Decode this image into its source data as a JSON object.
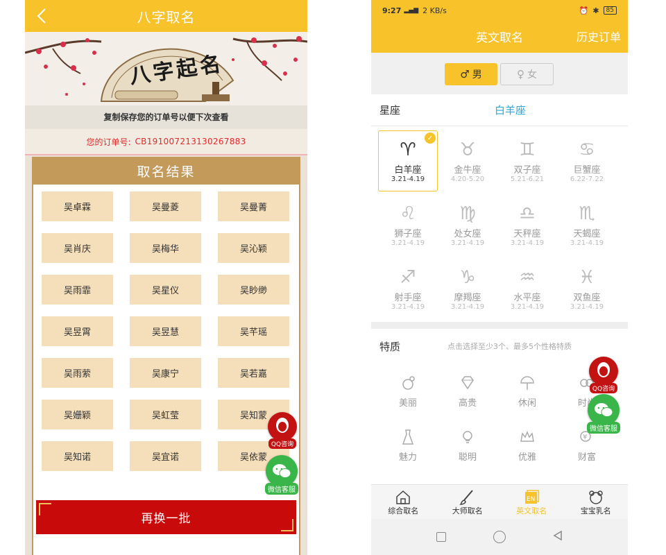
{
  "left": {
    "title": "八字取名",
    "banner_text": "八字起名",
    "copy_hint": "复制保存您的订单号以便下次查看",
    "order_label": "您的订单号:",
    "order_number": "CB191007213130267883",
    "result_title": "取名结果",
    "names": [
      "吴卓霖",
      "吴曼菱",
      "吴曼菁",
      "吴肖庆",
      "吴梅华",
      "吴沁颖",
      "吴雨霏",
      "吴星仪",
      "吴眇缈",
      "吴昱霄",
      "吴昱慧",
      "吴芊瑶",
      "吴雨萦",
      "吴康宁",
      "吴若嘉",
      "吴姗颖",
      "吴虹莹",
      "吴知蒙",
      "吴知诺",
      "吴宜诺",
      "吴依蒙"
    ],
    "refresh_button": "再换一批",
    "qq_label": "QQ咨询",
    "wechat_label": "微信客服"
  },
  "right": {
    "status": {
      "time": "9:27",
      "network": "2 KB/s",
      "battery": "85"
    },
    "title": "英文取名",
    "history": "历史订单",
    "gender": {
      "male": "男",
      "female": "女"
    },
    "zodiac_label": "星座",
    "zodiac_value": "白羊座",
    "zodiacs": [
      {
        "symbol": "♈",
        "name": "白羊座",
        "dates": "3.21-4.19",
        "selected": true
      },
      {
        "symbol": "♉",
        "name": "金牛座",
        "dates": "4.20-5.20"
      },
      {
        "symbol": "♊",
        "name": "双子座",
        "dates": "5.21-6.21"
      },
      {
        "symbol": "♋",
        "name": "巨蟹座",
        "dates": "6.22-7.22"
      },
      {
        "symbol": "♌",
        "name": "狮子座",
        "dates": "3.21-4.19"
      },
      {
        "symbol": "♍",
        "name": "处女座",
        "dates": "3.21-4.19"
      },
      {
        "symbol": "♎",
        "name": "天秤座",
        "dates": "3.21-4.19"
      },
      {
        "symbol": "♏",
        "name": "天蝎座",
        "dates": "3.21-4.19"
      },
      {
        "symbol": "♐",
        "name": "射手座",
        "dates": "3.21-4.19"
      },
      {
        "symbol": "♑",
        "name": "摩羯座",
        "dates": "3.21-4.19"
      },
      {
        "symbol": "♒",
        "name": "水平座",
        "dates": "3.21-4.19"
      },
      {
        "symbol": "♓",
        "name": "双鱼座",
        "dates": "3.21-4.19"
      }
    ],
    "trait_label": "特质",
    "trait_hint": "点击选择至少3个、最多5个性格特质",
    "traits": [
      {
        "name": "美丽",
        "icon": "beauty-icon"
      },
      {
        "name": "高贵",
        "icon": "diamond-icon"
      },
      {
        "name": "休闲",
        "icon": "beach-umbrella-icon"
      },
      {
        "name": "时尚",
        "icon": "fashion-icon"
      },
      {
        "name": "魅力",
        "icon": "dress-icon"
      },
      {
        "name": "聪明",
        "icon": "lightbulb-icon"
      },
      {
        "name": "优雅",
        "icon": "crown-icon"
      },
      {
        "name": "财富",
        "icon": "money-icon"
      }
    ],
    "tabs": [
      {
        "label": "综合取名",
        "icon": "home-icon"
      },
      {
        "label": "大师取名",
        "icon": "brush-icon"
      },
      {
        "label": "英文取名",
        "icon": "en-icon",
        "active": true
      },
      {
        "label": "宝宝乳名",
        "icon": "bear-icon"
      }
    ],
    "qq_label": "QQ咨询",
    "wechat_label": "微信客服"
  }
}
